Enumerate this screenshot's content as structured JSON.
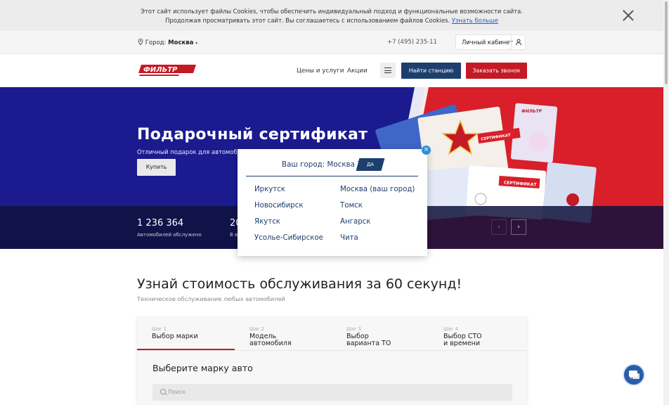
{
  "cookie": {
    "line1": "Этот сайт использует файлы Cookies, чтобы обеспечить индивидуальный подход и функциональные возможности сайта.",
    "line2": "Продолжая просматривать этот сайт. Вы соглашаетесь с использованием файлов Cookies.",
    "link": "Узнать больше"
  },
  "topbar": {
    "city_label": "Город:",
    "city_value": "Москва",
    "phone": "+7 (495) 235-11",
    "cabinet": "Личный кабинет"
  },
  "header": {
    "logo_text": "ФИЛЬТР",
    "nav": [
      "Цены и услуги",
      "Акции"
    ],
    "find_station": "Найти станцию",
    "order_call": "Заказать звонок"
  },
  "hero": {
    "title": "Подарочный сертификат",
    "subtitle": "Отличный подарок для автомобилист",
    "buy": "Купить",
    "stats": [
      {
        "value": "1 236 364",
        "label": "Автомобилей обслужено"
      },
      {
        "value": "20",
        "label": "В в"
      }
    ],
    "cert_label": "СЕРТИФИКАТ"
  },
  "modal": {
    "question": "Ваш город: Москва ?",
    "yes": "ДА",
    "close": "×",
    "cities_left": [
      "Иркутск",
      "Новосибирск",
      "Якутск",
      "Усолье-Сибирское"
    ],
    "cities_right": [
      "Москва (ваш город)",
      "Томск",
      "Ангарск",
      "Чита"
    ]
  },
  "calc": {
    "title": "Узнай стоимость обслуживания за 60 секунд!",
    "subtitle": "Техническое обслуживание любых автомобилей",
    "steps": [
      {
        "n": "Шаг 1",
        "t1": "Выбор марки",
        "t2": ""
      },
      {
        "n": "Шаг 2",
        "t1": "Модель",
        "t2": "автомобиля"
      },
      {
        "n": "Шаг 3",
        "t1": "Выбор",
        "t2": "варианта ТО"
      },
      {
        "n": "Шаг 4",
        "t1": "Выбор СТО",
        "t2": "и времени"
      }
    ],
    "brand_title": "Выберите марку авто",
    "search_placeholder": "Поиск"
  },
  "colors": {
    "brand_blue": "#1d3f6e",
    "brand_red": "#c41a26",
    "hero_blue": "#1b1b8f"
  }
}
